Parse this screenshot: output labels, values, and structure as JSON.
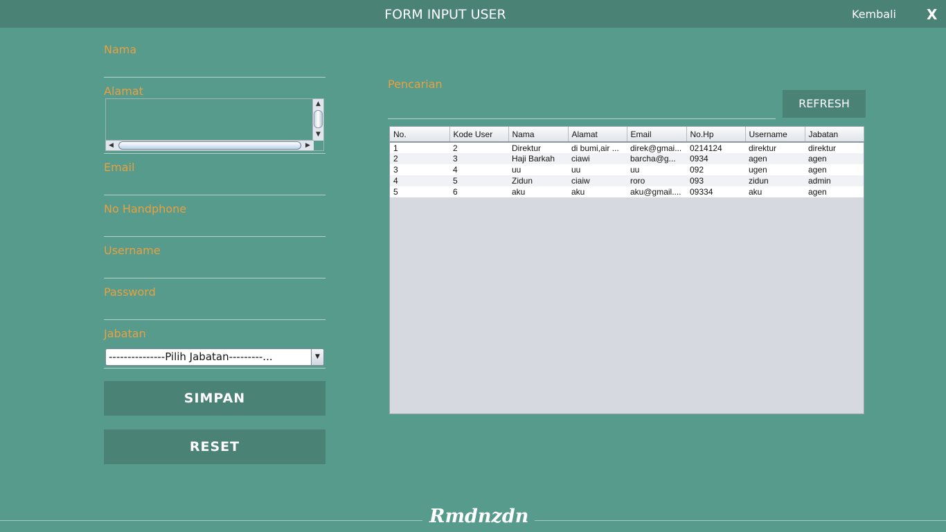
{
  "header": {
    "title": "FORM INPUT USER",
    "back_label": "Kembali",
    "close_label": "X"
  },
  "form": {
    "nama_label": "Nama",
    "alamat_label": "Alamat",
    "email_label": "Email",
    "handphone_label": "No Handphone",
    "username_label": "Username",
    "password_label": "Password",
    "jabatan_label": "Jabatan",
    "jabatan_selected": "---------------Pilih Jabatan---------...",
    "save_label": "SIMPAN",
    "reset_label": "RESET"
  },
  "search": {
    "label": "Pencarian",
    "refresh_label": "REFRESH"
  },
  "table": {
    "columns": [
      "No.",
      "Kode User",
      "Nama",
      "Alamat",
      "Email",
      "No.Hp",
      "Username",
      "Jabatan"
    ],
    "rows": [
      [
        "1",
        "2",
        "Direktur",
        "di bumi,air ...",
        "direk@gmai...",
        "0214124",
        "direktur",
        "direktur"
      ],
      [
        "2",
        "3",
        "Haji Barkah",
        "ciawi",
        "barcha@g...",
        "0934",
        "agen",
        "agen"
      ],
      [
        "3",
        "4",
        "uu",
        "uu",
        "uu",
        "092",
        "ugen",
        "agen"
      ],
      [
        "4",
        "5",
        "Zidun",
        "ciaiw",
        "roro",
        "093",
        "zidun",
        "admin"
      ],
      [
        "5",
        "6",
        "aku",
        "aku",
        "aku@gmail....",
        "09334",
        "aku",
        "agen"
      ]
    ]
  },
  "footer": {
    "signature": "Rmdnzdn"
  },
  "colors": {
    "background": "#579b8d",
    "header": "#4a8276",
    "label": "#e8a041"
  }
}
